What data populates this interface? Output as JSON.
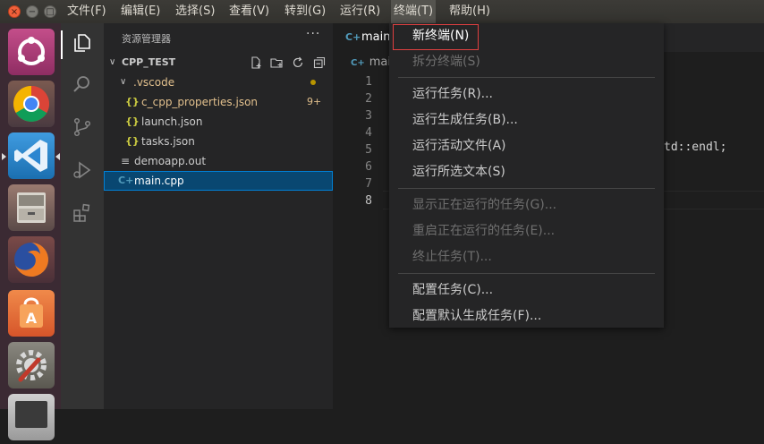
{
  "menubar": {
    "items": [
      "文件(F)",
      "编辑(E)",
      "选择(S)",
      "查看(V)",
      "转到(G)",
      "运行(R)",
      "终端(T)",
      "帮助(H)"
    ]
  },
  "explorer": {
    "title": "资源管理器",
    "more": "···",
    "folder": "CPP_TEST",
    "vscode_folder": ".vscode",
    "vscode_badge": "9+",
    "files": {
      "c_cpp_properties": "c_cpp_properties.json",
      "launch": "launch.json",
      "tasks": "tasks.json",
      "demoapp": "demoapp.out",
      "main": "main.cpp"
    },
    "json_icon_text": "{}",
    "cpp_icon_text": "C+"
  },
  "editor": {
    "tab_label": "main.",
    "breadcrumb": "main",
    "line_numbers": [
      "1",
      "2",
      "3",
      "4",
      "5",
      "6",
      "7",
      "8"
    ],
    "code_fragment": "td::endl;"
  },
  "terminal_menu": {
    "new_terminal": "新终端(N)",
    "split_terminal": "拆分终端(S)",
    "run_task": "运行任务(R)...",
    "run_build_task": "运行生成任务(B)...",
    "run_active_file": "运行活动文件(A)",
    "run_selected_text": "运行所选文本(S)",
    "show_running_tasks": "显示正在运行的任务(G)...",
    "restart_running_task": "重启正在运行的任务(E)...",
    "terminate_task": "终止任务(T)...",
    "configure_tasks": "配置任务(C)...",
    "configure_default_build_task": "配置默认生成任务(F)..."
  },
  "colors": {
    "accent_highlight": "#e04040",
    "selection": "#094771",
    "modified": "#e2c08d"
  }
}
